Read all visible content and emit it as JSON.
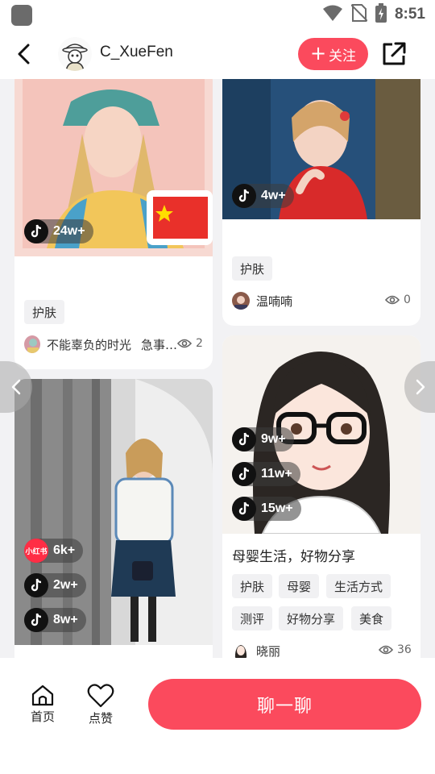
{
  "status_bar": {
    "time": "8:51"
  },
  "header": {
    "username": "C_XueFen",
    "follow_label": "关注",
    "follow_prefix": "+"
  },
  "cards": {
    "c1": {
      "badges": [
        {
          "platform": "tiktok",
          "count": "24w+"
        }
      ],
      "tags": [
        "护肤"
      ],
      "author": "不能辜负的时光",
      "author_extra": "急事…",
      "views": "2"
    },
    "c2": {
      "badges": [
        {
          "platform": "tiktok",
          "count": "4w+"
        }
      ],
      "tags": [
        "护肤"
      ],
      "author": "温喃喃",
      "views": "0"
    },
    "c3": {
      "badges": [
        {
          "platform": "xiaohongshu",
          "logo_text": "小红书",
          "count": "6k+"
        },
        {
          "platform": "tiktok",
          "count": "2w+"
        },
        {
          "platform": "tiktok",
          "count": "8w+"
        }
      ]
    },
    "c4": {
      "badges": [
        {
          "platform": "tiktok",
          "count": "9w+"
        },
        {
          "platform": "tiktok",
          "count": "11w+"
        },
        {
          "platform": "tiktok",
          "count": "15w+"
        }
      ],
      "title": "母婴生活，好物分享",
      "tags": [
        "护肤",
        "母婴",
        "生活方式",
        "测评",
        "好物分享",
        "美食"
      ],
      "author": "晓丽",
      "views": "36"
    }
  },
  "bottom_bar": {
    "home_label": "首页",
    "like_label": "点赞",
    "chat_label": "聊一聊"
  },
  "colors": {
    "accent": "#fb4a5d",
    "feed_bg": "#f2f2f4",
    "tag_bg": "#f1f1f3"
  },
  "icons": [
    "back-arrow-icon",
    "share-icon",
    "tiktok-icon",
    "xiaohongshu-icon",
    "eye-icon",
    "home-icon",
    "heart-icon",
    "chevron-left-icon",
    "chevron-right-icon",
    "wifi-icon",
    "no-sim-icon",
    "battery-icon"
  ]
}
